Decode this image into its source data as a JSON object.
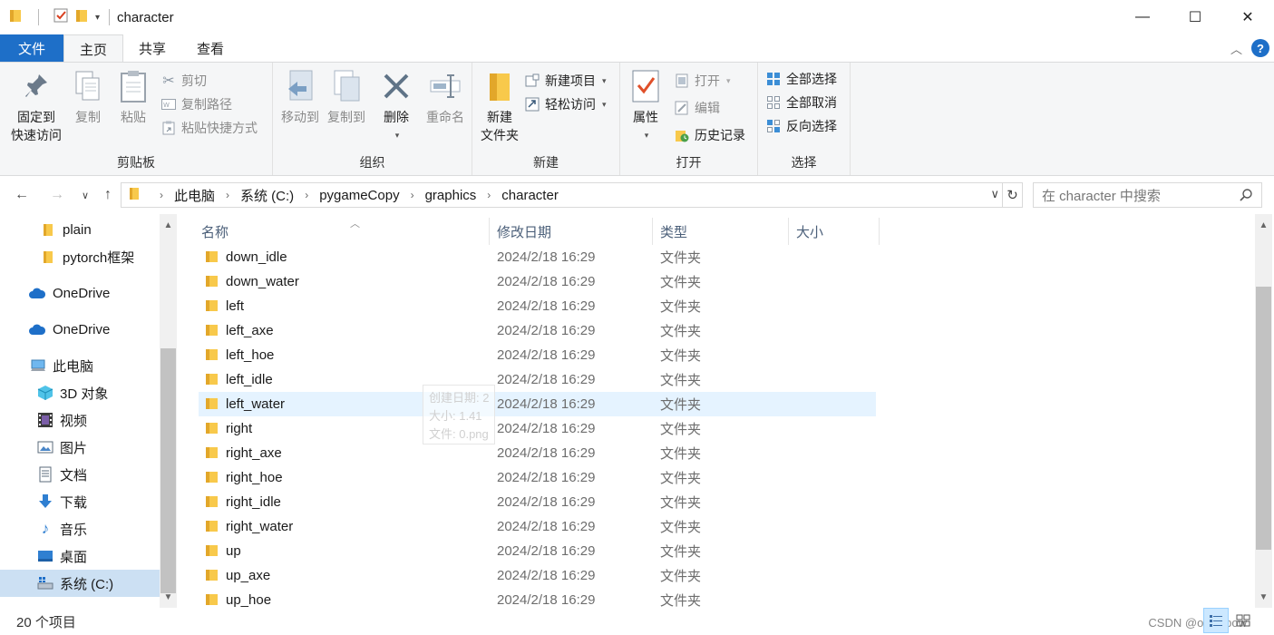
{
  "window": {
    "title": "character",
    "minimize": "—",
    "maximize": "☐",
    "close": "✕"
  },
  "tabs": [
    {
      "label": "文件"
    },
    {
      "label": "主页"
    },
    {
      "label": "共享"
    },
    {
      "label": "查看"
    }
  ],
  "ribbon": {
    "clipboard": {
      "label": "剪贴板",
      "pin_line1": "固定到",
      "pin_line2": "快速访问",
      "copy": "复制",
      "paste": "粘贴",
      "cut": "剪切",
      "copy_path": "复制路径",
      "paste_shortcut": "粘贴快捷方式"
    },
    "organize": {
      "label": "组织",
      "move_to": "移动到",
      "copy_to": "复制到",
      "delete": "删除",
      "rename": "重命名"
    },
    "new": {
      "label": "新建",
      "new_folder_line1": "新建",
      "new_folder_line2": "文件夹",
      "new_item": "新建项目",
      "easy_access": "轻松访问"
    },
    "open": {
      "label": "打开",
      "properties": "属性",
      "open": "打开",
      "edit": "编辑",
      "history": "历史记录"
    },
    "select": {
      "label": "选择",
      "select_all": "全部选择",
      "select_none": "全部取消",
      "invert": "反向选择"
    }
  },
  "address": {
    "crumbs": [
      "此电脑",
      "系统 (C:)",
      "pygameCopy",
      "graphics",
      "character"
    ],
    "search_placeholder": "在 character 中搜索"
  },
  "sidebar": {
    "items": [
      {
        "label": "plain",
        "icon": "folder-icon"
      },
      {
        "label": "pytorch框架",
        "icon": "folder-icon"
      },
      {
        "label": "OneDrive",
        "icon": "cloud-icon"
      },
      {
        "label": "OneDrive",
        "icon": "cloud-icon"
      },
      {
        "label": "此电脑",
        "icon": "computer-icon"
      },
      {
        "label": "3D 对象",
        "icon": "cube-icon"
      },
      {
        "label": "视频",
        "icon": "film-icon"
      },
      {
        "label": "图片",
        "icon": "picture-icon"
      },
      {
        "label": "文档",
        "icon": "document-icon"
      },
      {
        "label": "下载",
        "icon": "download-icon"
      },
      {
        "label": "音乐",
        "icon": "music-icon"
      },
      {
        "label": "桌面",
        "icon": "desktop-icon"
      },
      {
        "label": "系统 (C:)",
        "icon": "drive-icon"
      }
    ]
  },
  "columns": {
    "name": "名称",
    "date": "修改日期",
    "type": "类型",
    "size": "大小"
  },
  "files": [
    {
      "name": "down_idle",
      "date": "2024/2/18 16:29",
      "type": "文件夹"
    },
    {
      "name": "down_water",
      "date": "2024/2/18 16:29",
      "type": "文件夹"
    },
    {
      "name": "left",
      "date": "2024/2/18 16:29",
      "type": "文件夹"
    },
    {
      "name": "left_axe",
      "date": "2024/2/18 16:29",
      "type": "文件夹"
    },
    {
      "name": "left_hoe",
      "date": "2024/2/18 16:29",
      "type": "文件夹"
    },
    {
      "name": "left_idle",
      "date": "2024/2/18 16:29",
      "type": "文件夹"
    },
    {
      "name": "left_water",
      "date": "2024/2/18 16:29",
      "type": "文件夹"
    },
    {
      "name": "right",
      "date": "2024/2/18 16:29",
      "type": "文件夹"
    },
    {
      "name": "right_axe",
      "date": "2024/2/18 16:29",
      "type": "文件夹"
    },
    {
      "name": "right_hoe",
      "date": "2024/2/18 16:29",
      "type": "文件夹"
    },
    {
      "name": "right_idle",
      "date": "2024/2/18 16:29",
      "type": "文件夹"
    },
    {
      "name": "right_water",
      "date": "2024/2/18 16:29",
      "type": "文件夹"
    },
    {
      "name": "up",
      "date": "2024/2/18 16:29",
      "type": "文件夹"
    },
    {
      "name": "up_axe",
      "date": "2024/2/18 16:29",
      "type": "文件夹"
    },
    {
      "name": "up_hoe",
      "date": "2024/2/18 16:29",
      "type": "文件夹"
    }
  ],
  "tooltip": {
    "line1": "创建日期: 2",
    "line2": "大小: 1.41",
    "line3": "文件: 0.png"
  },
  "status": {
    "count": "20 个项目",
    "watermark": "CSDN @owogpow"
  },
  "colors": {
    "accent": "#1e6fc8",
    "folder": "#f8c94b",
    "selected": "#cce0f3",
    "hover": "#e5f3ff"
  }
}
